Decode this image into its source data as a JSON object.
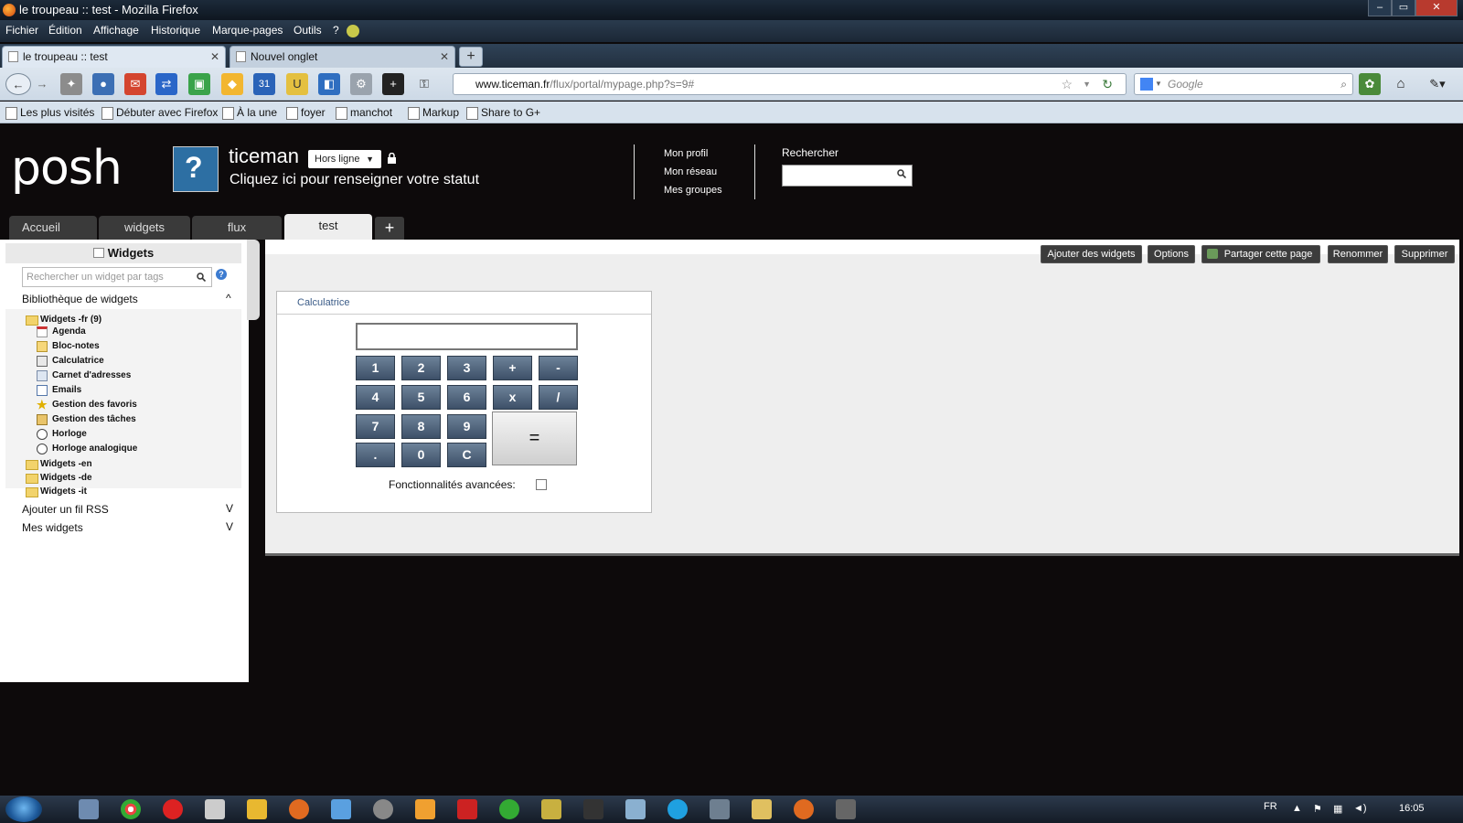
{
  "browser": {
    "window_title": "le troupeau :: test - Mozilla Firefox",
    "window_controls": [
      "–",
      "▭",
      "✕"
    ],
    "menu": [
      "Fichier",
      "Édition",
      "Affichage",
      "Historique",
      "Marque-pages",
      "Outils",
      "?"
    ],
    "tabs": [
      {
        "label": "le troupeau :: test",
        "active": true
      },
      {
        "label": "Nouvel onglet",
        "active": false
      }
    ],
    "new_tab_label": "+",
    "url_domain": "www.ticeman.fr",
    "url_path": "/flux/portal/mypage.php?s=9#",
    "search_placeholder": "Google",
    "bookmarks": [
      "Les plus visités",
      "Débuter avec Firefox",
      "À la une",
      "foyer",
      "manchot",
      "Markup",
      "Share to G+"
    ]
  },
  "portal": {
    "logo": "posh",
    "username": "ticeman",
    "presence": "Hors ligne",
    "status_prompt": "Cliquez ici pour renseigner votre statut",
    "profile_links": [
      "Mon profil",
      "Mon réseau",
      "Mes groupes"
    ],
    "search_label": "Rechercher",
    "tabs": [
      {
        "label": "Accueil",
        "active": false
      },
      {
        "label": "widgets",
        "active": false
      },
      {
        "label": "flux",
        "active": false
      },
      {
        "label": "test",
        "active": true
      }
    ],
    "add_tab": "+"
  },
  "sidebar": {
    "title": "Widgets",
    "search_placeholder": "Rechercher un widget par tags",
    "library_title": "Bibliothèque de widgets",
    "library_chevron": "^",
    "folder_fr": "Widgets -fr (9)",
    "widgets_fr": [
      "Agenda",
      "Bloc-notes",
      "Calculatrice",
      "Carnet d'adresses",
      "Emails",
      "Gestion des favoris",
      "Gestion des tâches",
      "Horloge",
      "Horloge analogique"
    ],
    "folders_other": [
      "Widgets -en",
      "Widgets -de",
      "Widgets -it"
    ],
    "sections": [
      "Ajouter un fil RSS",
      "Mes widgets"
    ],
    "section_chevron": "V"
  },
  "page_actions": [
    "Ajouter des widgets",
    "Options",
    "Partager cette page",
    "Renommer",
    "Supprimer"
  ],
  "calculator": {
    "title": "Calculatrice",
    "keys": [
      "1",
      "2",
      "3",
      "+",
      "-",
      "4",
      "5",
      "6",
      "x",
      "/",
      "7",
      "8",
      "9",
      ".",
      "0",
      "C"
    ],
    "equals": "=",
    "advanced_label": "Fonctionnalités avancées:"
  },
  "taskbar": {
    "lang": "FR",
    "clock": "16:05"
  },
  "colors": {
    "page_bg": "#0d0a0b",
    "calc_key": "#4e6380",
    "content_bg": "#eeeeee"
  }
}
